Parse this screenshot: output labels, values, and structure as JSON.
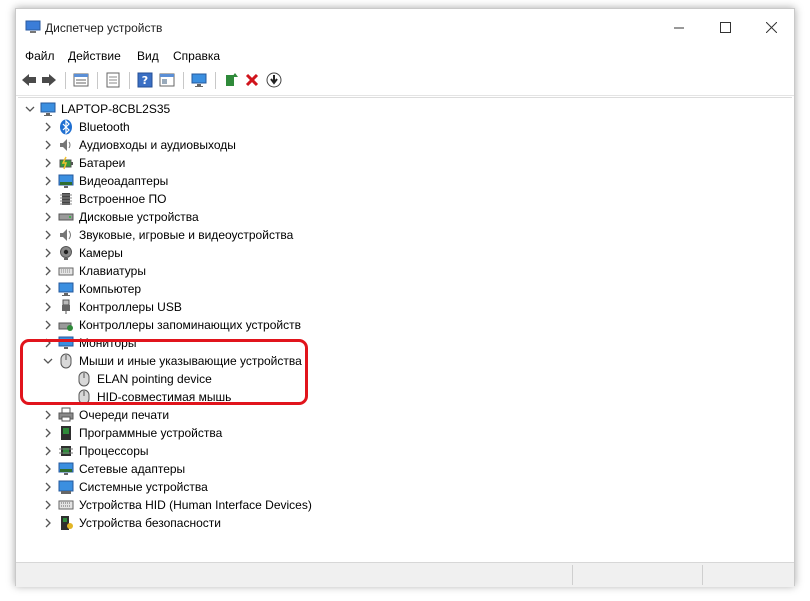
{
  "window": {
    "title": "Диспетчер устройств"
  },
  "menu": [
    "Файл",
    "Действие",
    "Вид",
    "Справка"
  ],
  "toolbar": [
    "back-icon",
    "forward-icon",
    "properties-list-icon",
    "show-all-icon",
    "help-icon",
    "view-icon",
    "monitor-icon",
    "update-driver-icon",
    "remove-icon",
    "download-icon"
  ],
  "tree": {
    "root": "LAPTOP-8CBL2S35",
    "categories": [
      {
        "label": "Bluetooth",
        "icon": "bluetooth-icon"
      },
      {
        "label": "Аудиовходы и аудиовыходы",
        "icon": "speaker-icon"
      },
      {
        "label": "Батареи",
        "icon": "battery-icon"
      },
      {
        "label": "Видеоадаптеры",
        "icon": "display-adapter-icon"
      },
      {
        "label": "Встроенное ПО",
        "icon": "firmware-icon"
      },
      {
        "label": "Дисковые устройства",
        "icon": "disk-icon"
      },
      {
        "label": "Звуковые, игровые и видеоустройства",
        "icon": "sound-icon"
      },
      {
        "label": "Камеры",
        "icon": "camera-icon"
      },
      {
        "label": "Клавиатуры",
        "icon": "keyboard-icon"
      },
      {
        "label": "Компьютер",
        "icon": "computer-icon"
      },
      {
        "label": "Контроллеры USB",
        "icon": "usb-icon"
      },
      {
        "label": "Контроллеры запоминающих устройств",
        "icon": "storage-controller-icon"
      },
      {
        "label": "Мониторы",
        "icon": "monitor-icon"
      },
      {
        "label": "Мыши и иные указывающие устройства",
        "icon": "mouse-icon",
        "expanded": true,
        "children": [
          {
            "label": "ELAN pointing device",
            "icon": "mouse-icon"
          },
          {
            "label": "HID-совместимая мышь",
            "icon": "mouse-icon"
          }
        ]
      },
      {
        "label": "Очереди печати",
        "icon": "printer-icon"
      },
      {
        "label": "Программные устройства",
        "icon": "software-device-icon"
      },
      {
        "label": "Процессоры",
        "icon": "processor-icon"
      },
      {
        "label": "Сетевые адаптеры",
        "icon": "network-adapter-icon"
      },
      {
        "label": "Системные устройства",
        "icon": "system-device-icon"
      },
      {
        "label": "Устройства HID (Human Interface Devices)",
        "icon": "hid-icon"
      },
      {
        "label": "Устройства безопасности",
        "icon": "security-device-icon"
      }
    ]
  },
  "colors": {
    "highlight": "#e1141c",
    "accent": "#1f6fd1"
  }
}
